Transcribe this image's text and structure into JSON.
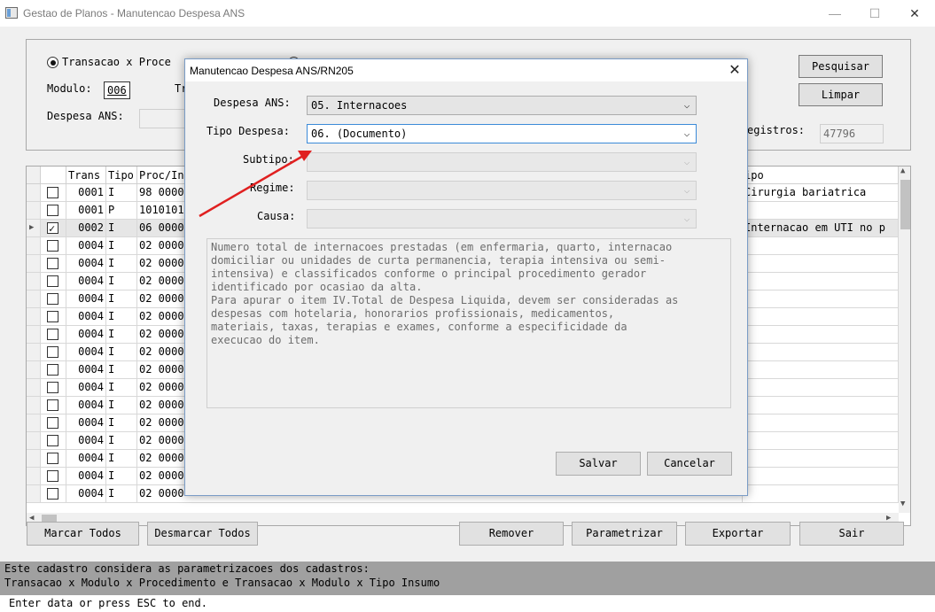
{
  "window": {
    "title": "Gestao de Planos - Manutencao Despesa ANS",
    "minimize": "—",
    "maximize": "☐",
    "close": "✕"
  },
  "filter": {
    "radio1_label": "Transacao x Proce",
    "radio2_label": "",
    "modulo_label": "Modulo:",
    "modulo_value": "006",
    "tr_label": "Tr",
    "despesa_label": "Despesa ANS:",
    "registros_label": "egistros:",
    "registros_value": "47796",
    "pesquisar": "Pesquisar",
    "limpar": "Limpar"
  },
  "grid": {
    "headers": [
      "Trans",
      "Tipo",
      "Proc/In",
      "ipo"
    ],
    "rows": [
      {
        "trans": "0001",
        "tipo": "I",
        "proc": "98 0000",
        "desc": "Cirurgia bariatrica",
        "checked": false,
        "selected": false
      },
      {
        "trans": "0001",
        "tipo": "P",
        "proc": "1010101",
        "desc": "",
        "checked": false,
        "selected": false
      },
      {
        "trans": "0002",
        "tipo": "I",
        "proc": "06 0000",
        "desc": "Internacao em UTI no p",
        "checked": true,
        "selected": true
      },
      {
        "trans": "0004",
        "tipo": "I",
        "proc": "02 0000",
        "desc": "",
        "checked": false,
        "selected": false
      },
      {
        "trans": "0004",
        "tipo": "I",
        "proc": "02 0000",
        "desc": "",
        "checked": false,
        "selected": false
      },
      {
        "trans": "0004",
        "tipo": "I",
        "proc": "02 0000",
        "desc": "",
        "checked": false,
        "selected": false
      },
      {
        "trans": "0004",
        "tipo": "I",
        "proc": "02 0000",
        "desc": "",
        "checked": false,
        "selected": false
      },
      {
        "trans": "0004",
        "tipo": "I",
        "proc": "02 0000",
        "desc": "",
        "checked": false,
        "selected": false
      },
      {
        "trans": "0004",
        "tipo": "I",
        "proc": "02 0000",
        "desc": "",
        "checked": false,
        "selected": false
      },
      {
        "trans": "0004",
        "tipo": "I",
        "proc": "02 0000",
        "desc": "",
        "checked": false,
        "selected": false
      },
      {
        "trans": "0004",
        "tipo": "I",
        "proc": "02 0000",
        "desc": "",
        "checked": false,
        "selected": false
      },
      {
        "trans": "0004",
        "tipo": "I",
        "proc": "02 0000",
        "desc": "",
        "checked": false,
        "selected": false
      },
      {
        "trans": "0004",
        "tipo": "I",
        "proc": "02 0000",
        "desc": "",
        "checked": false,
        "selected": false
      },
      {
        "trans": "0004",
        "tipo": "I",
        "proc": "02 0000",
        "desc": "",
        "checked": false,
        "selected": false
      },
      {
        "trans": "0004",
        "tipo": "I",
        "proc": "02 0000",
        "desc": "",
        "checked": false,
        "selected": false
      },
      {
        "trans": "0004",
        "tipo": "I",
        "proc": "02 0000",
        "desc": "",
        "checked": false,
        "selected": false
      },
      {
        "trans": "0004",
        "tipo": "I",
        "proc": "02 0000",
        "desc": "",
        "checked": false,
        "selected": false
      },
      {
        "trans": "0004",
        "tipo": "I",
        "proc": "02 0000",
        "desc": "",
        "checked": false,
        "selected": false
      }
    ]
  },
  "bottom_buttons": {
    "marcar_todos": "Marcar Todos",
    "desmarcar_todos": "Desmarcar Todos",
    "remover": "Remover",
    "parametrizar": "Parametrizar",
    "exportar": "Exportar",
    "sair": "Sair"
  },
  "status": {
    "line1": "Este cadastro considera as parametrizacoes dos cadastros:",
    "line2": "Transacao x Modulo x Procedimento e Transacao x Modulo x Tipo Insumo",
    "prompt": "Enter data or press ESC to end."
  },
  "modal": {
    "title": "Manutencao Despesa ANS/RN205",
    "close": "✕",
    "despesa_label": "Despesa ANS:",
    "despesa_value": "05. Internacoes",
    "tipo_label": "Tipo Despesa:",
    "tipo_value": "06. (Documento)",
    "subtipo_label": "Subtipo:",
    "regime_label": "Regime:",
    "causa_label": "Causa:",
    "description": "Numero total de internacoes prestadas (em enfermaria, quarto, internacao\ndomiciliar ou unidades de curta permanencia, terapia intensiva ou semi-\nintensiva) e classificados conforme o principal procedimento gerador\nidentificado por ocasiao da alta.\nPara apurar o item IV.Total de Despesa Liquida, devem ser consideradas as\ndespesas com hotelaria, honorarios profissionais, medicamentos,\nmateriais, taxas, terapias e exames, conforme a especificidade da\nexecucao do item.",
    "salvar": "Salvar",
    "cancelar": "Cancelar"
  },
  "colors": {
    "annotation_arrow": "#e02020",
    "focus_border": "#3b8ad8",
    "status_bar": "#a0a0a0"
  }
}
